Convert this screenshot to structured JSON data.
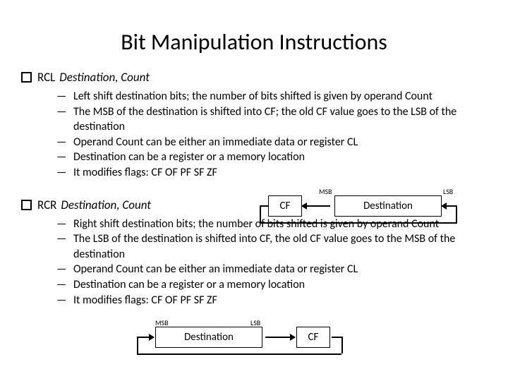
{
  "title": "Bit Manipulation Instructions",
  "rcl": {
    "mnemonic": "RCL",
    "args": "Destination, Count",
    "items": [
      "Left shift destination bits; the number of bits shifted is given by operand Count",
      "The MSB of the destination is shifted into CF; the old CF value goes to the LSB of the destination",
      "Operand Count can be either an immediate data or register CL",
      "Destination can be a register or a memory location",
      "It modifies flags: CF OF PF SF ZF"
    ],
    "diagram": {
      "cf": "CF",
      "dest": "Destination",
      "msb": "MSB",
      "lsb": "LSB"
    }
  },
  "rcr": {
    "mnemonic": "RCR",
    "args": "Destination, Count",
    "items": [
      "Right shift destination bits; the number of bits shifted is given by operand Count",
      "The LSB of the destination is shifted into CF,  the old CF value goes to the MSB of the destination",
      "Operand Count can be either an immediate data or register CL",
      "Destination can be a register or a memory location",
      "It modifies flags: CF OF PF SF ZF"
    ],
    "diagram": {
      "cf": "CF",
      "dest": "Destination",
      "msb": "MSB",
      "lsb": "LSB"
    }
  }
}
